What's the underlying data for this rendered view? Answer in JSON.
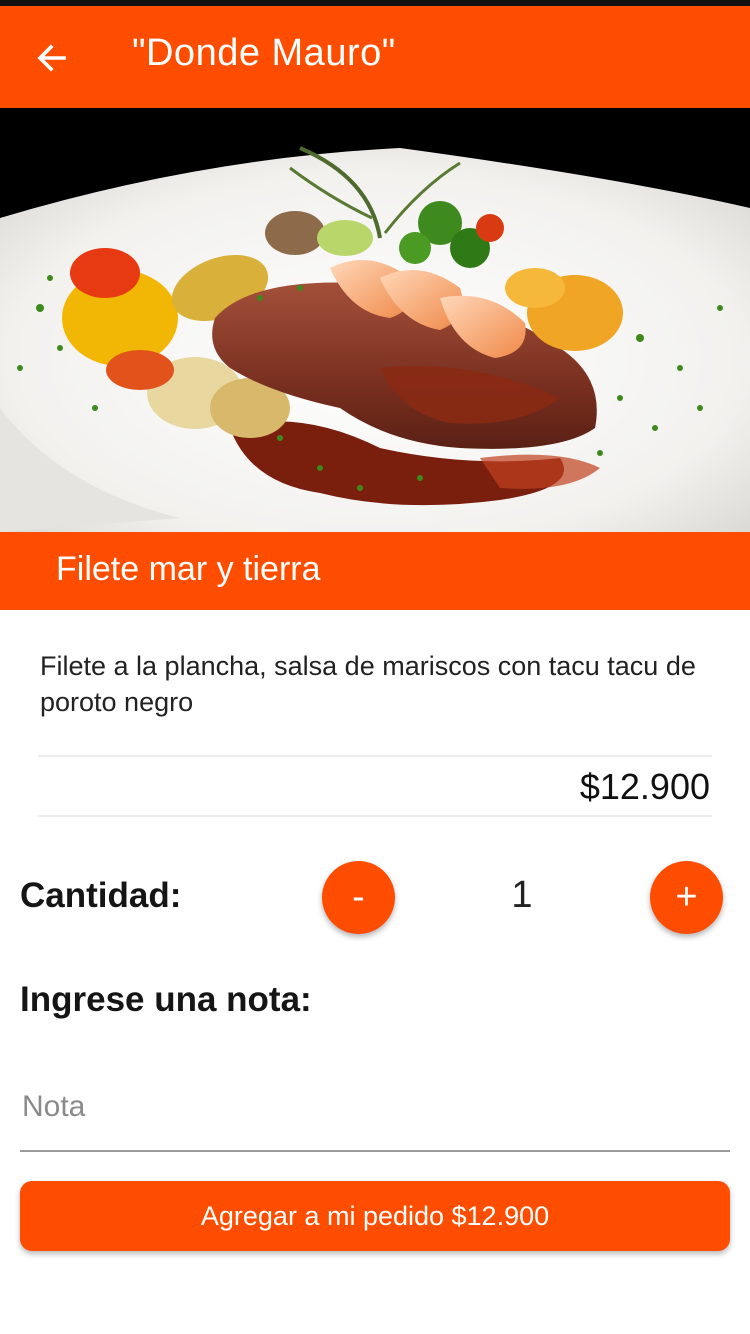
{
  "header": {
    "title": "\"Donde Mauro\"",
    "back_icon": "arrow-left-icon"
  },
  "hero": {
    "image": "dish-photo"
  },
  "dish": {
    "name": "Filete mar y tierra",
    "description": "Filete a la plancha, salsa de mariscos con tacu tacu de poroto negro",
    "price": "$12.900"
  },
  "quantity": {
    "label": "Cantidad:",
    "minus_label": "-",
    "plus_label": "+",
    "value": "1"
  },
  "note": {
    "label": "Ingrese una nota:",
    "placeholder": "Nota",
    "value": ""
  },
  "action": {
    "add_label": "Agregar a mi pedido $12.900"
  },
  "colors": {
    "accent": "#ff4d00",
    "text": "#151515"
  }
}
